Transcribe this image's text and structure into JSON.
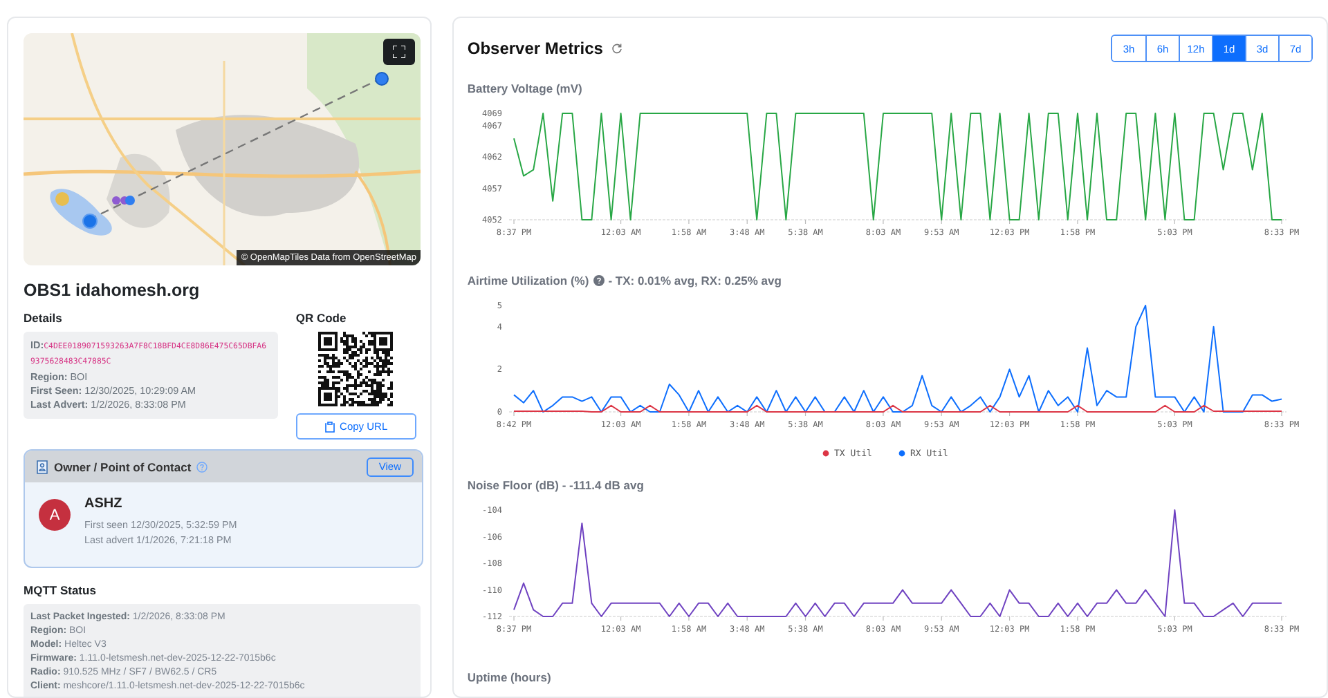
{
  "map": {
    "kind": "picture",
    "attribution": "© OpenMapTiles Data from OpenStreetMap"
  },
  "observer": {
    "title": "OBS1 idahomesh.org"
  },
  "details": {
    "heading": "Details",
    "id_label": "ID:",
    "id": "C4DEE0189071593263A7F8C18BFD4CE8D86E475C65DBFA69375628483C47885C",
    "lines": [
      "**Region:** BOI",
      "**First Seen:** 12/30/2025, 10:29:09 AM",
      "**Last Advert:** 1/2/2026, 8:33:08 PM"
    ]
  },
  "qr": {
    "heading": "QR Code",
    "button": "Copy URL"
  },
  "owner": {
    "heading": "Owner / Point of Contact",
    "help": true,
    "button": "View",
    "initial": "A",
    "name": "ASHZ",
    "first_seen": "First seen 12/30/2025, 5:32:59 PM",
    "last_advert": "Last advert 1/1/2026, 7:21:18 PM"
  },
  "mqtt": {
    "heading": "MQTT Status",
    "lines": [
      "**Last Packet Ingested:** 1/2/2026, 8:33:08 PM",
      "**Region:** BOI",
      "**Model:** Heltec V3",
      "**Firmware:** 1.11.0-letsmesh.net-dev-2025-12-22-7015b6c",
      "**Radio:** 910.525 MHz / SF7 / BW62.5 / CR5",
      "**Client:** meshcore/1.11.0-letsmesh.net-dev-2025-12-22-7015b6c"
    ]
  },
  "metrics": {
    "title": "Observer Metrics",
    "ranges": [
      {
        "label": "3h",
        "selected": false
      },
      {
        "label": "6h",
        "selected": false
      },
      {
        "label": "12h",
        "selected": false
      },
      {
        "label": "1d",
        "selected": true
      },
      {
        "label": "3d",
        "selected": false
      },
      {
        "label": "7d",
        "selected": false
      }
    ],
    "sections": [
      {
        "heading": "Battery Voltage (mV)",
        "chart_data": {
          "type": "line",
          "ylim": [
            4052,
            4069
          ],
          "yticks": [
            4052,
            4057,
            4062,
            4067,
            4069
          ],
          "categories": [
            "8:37 PM",
            null,
            null,
            null,
            null,
            null,
            null,
            null,
            null,
            null,
            null,
            "12:03 AM",
            null,
            null,
            null,
            null,
            null,
            null,
            "1:58 AM",
            null,
            null,
            null,
            null,
            null,
            "3:48 AM",
            null,
            null,
            null,
            null,
            null,
            "5:38 AM",
            null,
            null,
            null,
            null,
            null,
            null,
            null,
            "8:03 AM",
            null,
            null,
            null,
            null,
            null,
            "9:53 AM",
            null,
            null,
            null,
            null,
            null,
            null,
            "12:03 PM",
            null,
            null,
            null,
            null,
            null,
            null,
            "1:58 PM",
            null,
            null,
            null,
            null,
            null,
            null,
            null,
            null,
            null,
            "5:03 PM",
            null,
            null,
            null,
            null,
            null,
            null,
            null,
            null,
            null,
            null,
            "8:33 PM"
          ],
          "series": [
            {
              "color": "#28a745",
              "values": [
                4065,
                4059,
                4060,
                4069,
                4055,
                4069,
                4069,
                4052,
                4052,
                4069,
                4052,
                4069,
                4052,
                4069,
                4069,
                4069,
                4069,
                4069,
                4069,
                4069,
                4069,
                4069,
                4069,
                4069,
                4069,
                4052,
                4069,
                4069,
                4052,
                4069,
                4069,
                4069,
                4069,
                4069,
                4069,
                4069,
                4069,
                4052,
                4069,
                4069,
                4069,
                4069,
                4069,
                4069,
                4052,
                4069,
                4052,
                4069,
                4069,
                4052,
                4069,
                4052,
                4052,
                4069,
                4052,
                4069,
                4069,
                4052,
                4069,
                4052,
                4069,
                4052,
                4052,
                4069,
                4069,
                4052,
                4069,
                4052,
                4069,
                4052,
                4052,
                4069,
                4069,
                4060,
                4069,
                4069,
                4060,
                4069,
                4052,
                4052
              ]
            }
          ]
        }
      },
      {
        "heading": "Airtime Utilization (%)",
        "help": true,
        "summary": "- TX: 0.01% avg, RX: 0.25% avg",
        "chart_data": {
          "type": "line",
          "legend": true,
          "ylim": [
            0,
            5
          ],
          "yticks": [
            0,
            2,
            4,
            5
          ],
          "categories": [
            "8:42 PM",
            null,
            null,
            null,
            null,
            null,
            null,
            null,
            null,
            null,
            null,
            "12:03 AM",
            null,
            null,
            null,
            null,
            null,
            null,
            "1:58 AM",
            null,
            null,
            null,
            null,
            null,
            "3:48 AM",
            null,
            null,
            null,
            null,
            null,
            "5:38 AM",
            null,
            null,
            null,
            null,
            null,
            null,
            null,
            "8:03 AM",
            null,
            null,
            null,
            null,
            null,
            "9:53 AM",
            null,
            null,
            null,
            null,
            null,
            null,
            "12:03 PM",
            null,
            null,
            null,
            null,
            null,
            null,
            "1:58 PM",
            null,
            null,
            null,
            null,
            null,
            null,
            null,
            null,
            null,
            "5:03 PM",
            null,
            null,
            null,
            null,
            null,
            null,
            null,
            null,
            null,
            null,
            "8:33 PM"
          ],
          "series": [
            {
              "name": "TX Util",
              "color": "#dc3545",
              "values": [
                0.03,
                0.03,
                0.03,
                0.03,
                0.03,
                0.03,
                0.03,
                0.03,
                0,
                0,
                0.3,
                0,
                0,
                0,
                0.3,
                0,
                0,
                0,
                0,
                0,
                0,
                0,
                0,
                0,
                0,
                0.3,
                0,
                0,
                0,
                0,
                0,
                0,
                0,
                0,
                0,
                0,
                0,
                0,
                0,
                0.3,
                0,
                0,
                0,
                0,
                0,
                0,
                0,
                0,
                0,
                0.3,
                0,
                0,
                0,
                0,
                0,
                0,
                0,
                0,
                0.3,
                0,
                0,
                0,
                0,
                0,
                0,
                0,
                0,
                0.3,
                0,
                0,
                0,
                0.3,
                0.03,
                0.03,
                0.03,
                0.03,
                0.03,
                0.03,
                0.03,
                0.03
              ]
            },
            {
              "name": "RX Util",
              "color": "#0d6efd",
              "values": [
                0.8,
                0.43,
                1,
                0,
                0.3,
                0.7,
                0.7,
                0.5,
                0.7,
                0,
                0.7,
                0.7,
                0,
                0.3,
                0,
                0,
                1.3,
                0.8,
                0,
                1,
                0,
                0.7,
                0,
                0.3,
                0,
                0.7,
                0,
                1,
                0,
                0.7,
                0,
                0.7,
                0,
                0,
                0.7,
                0,
                1,
                0,
                0.7,
                0,
                0,
                0.3,
                1.7,
                0.3,
                0,
                0.7,
                0,
                0.3,
                0.7,
                0,
                0.7,
                2,
                0.7,
                1.7,
                0,
                1,
                0.3,
                0.7,
                0,
                3,
                0.3,
                1,
                0.7,
                0.7,
                4,
                5,
                0.7,
                0.7,
                0.7,
                0,
                0.7,
                0,
                4,
                0,
                0,
                0,
                0.8,
                0.8,
                0.5,
                0.6
              ]
            }
          ]
        }
      },
      {
        "heading": "Noise Floor (dB) - -111.4 dB avg",
        "chart_data": {
          "type": "line",
          "ylim": [
            -112,
            -104
          ],
          "yticks": [
            -112,
            -110,
            -108,
            -106,
            -104
          ],
          "categories": [
            "8:37 PM",
            null,
            null,
            null,
            null,
            null,
            null,
            null,
            null,
            null,
            null,
            "12:03 AM",
            null,
            null,
            null,
            null,
            null,
            null,
            "1:58 AM",
            null,
            null,
            null,
            null,
            null,
            "3:48 AM",
            null,
            null,
            null,
            null,
            null,
            "5:38 AM",
            null,
            null,
            null,
            null,
            null,
            null,
            null,
            "8:03 AM",
            null,
            null,
            null,
            null,
            null,
            "9:53 AM",
            null,
            null,
            null,
            null,
            null,
            null,
            "12:03 PM",
            null,
            null,
            null,
            null,
            null,
            null,
            "1:58 PM",
            null,
            null,
            null,
            null,
            null,
            null,
            null,
            null,
            null,
            "5:03 PM",
            null,
            null,
            null,
            null,
            null,
            null,
            null,
            null,
            null,
            null,
            "8:33 PM"
          ],
          "series": [
            {
              "color": "#6f42c1",
              "values": [
                -111.5,
                -109.5,
                -111.5,
                -112,
                -112,
                -111,
                -111,
                -105,
                -111,
                -112,
                -111,
                -111,
                -111,
                -111,
                -111,
                -111,
                -112,
                -111,
                -112,
                -111,
                -111,
                -112,
                -111,
                -112,
                -112,
                -112,
                -112,
                -112,
                -112,
                -111,
                -112,
                -111,
                -112,
                -111,
                -111,
                -112,
                -111,
                -111,
                -111,
                -111,
                -110,
                -111,
                -111,
                -111,
                -111,
                -110,
                -111,
                -112,
                -112,
                -111,
                -112,
                -110,
                -111,
                -111,
                -112,
                -112,
                -111,
                -112,
                -111,
                -112,
                -111,
                -111,
                -110,
                -111,
                -111,
                -110,
                -111,
                -112,
                -104,
                -111,
                -111,
                -112,
                -112,
                -111.5,
                -111,
                -112,
                -111,
                -111,
                -111,
                -111
              ]
            }
          ]
        }
      },
      {
        "heading": "Uptime (hours)"
      }
    ]
  }
}
